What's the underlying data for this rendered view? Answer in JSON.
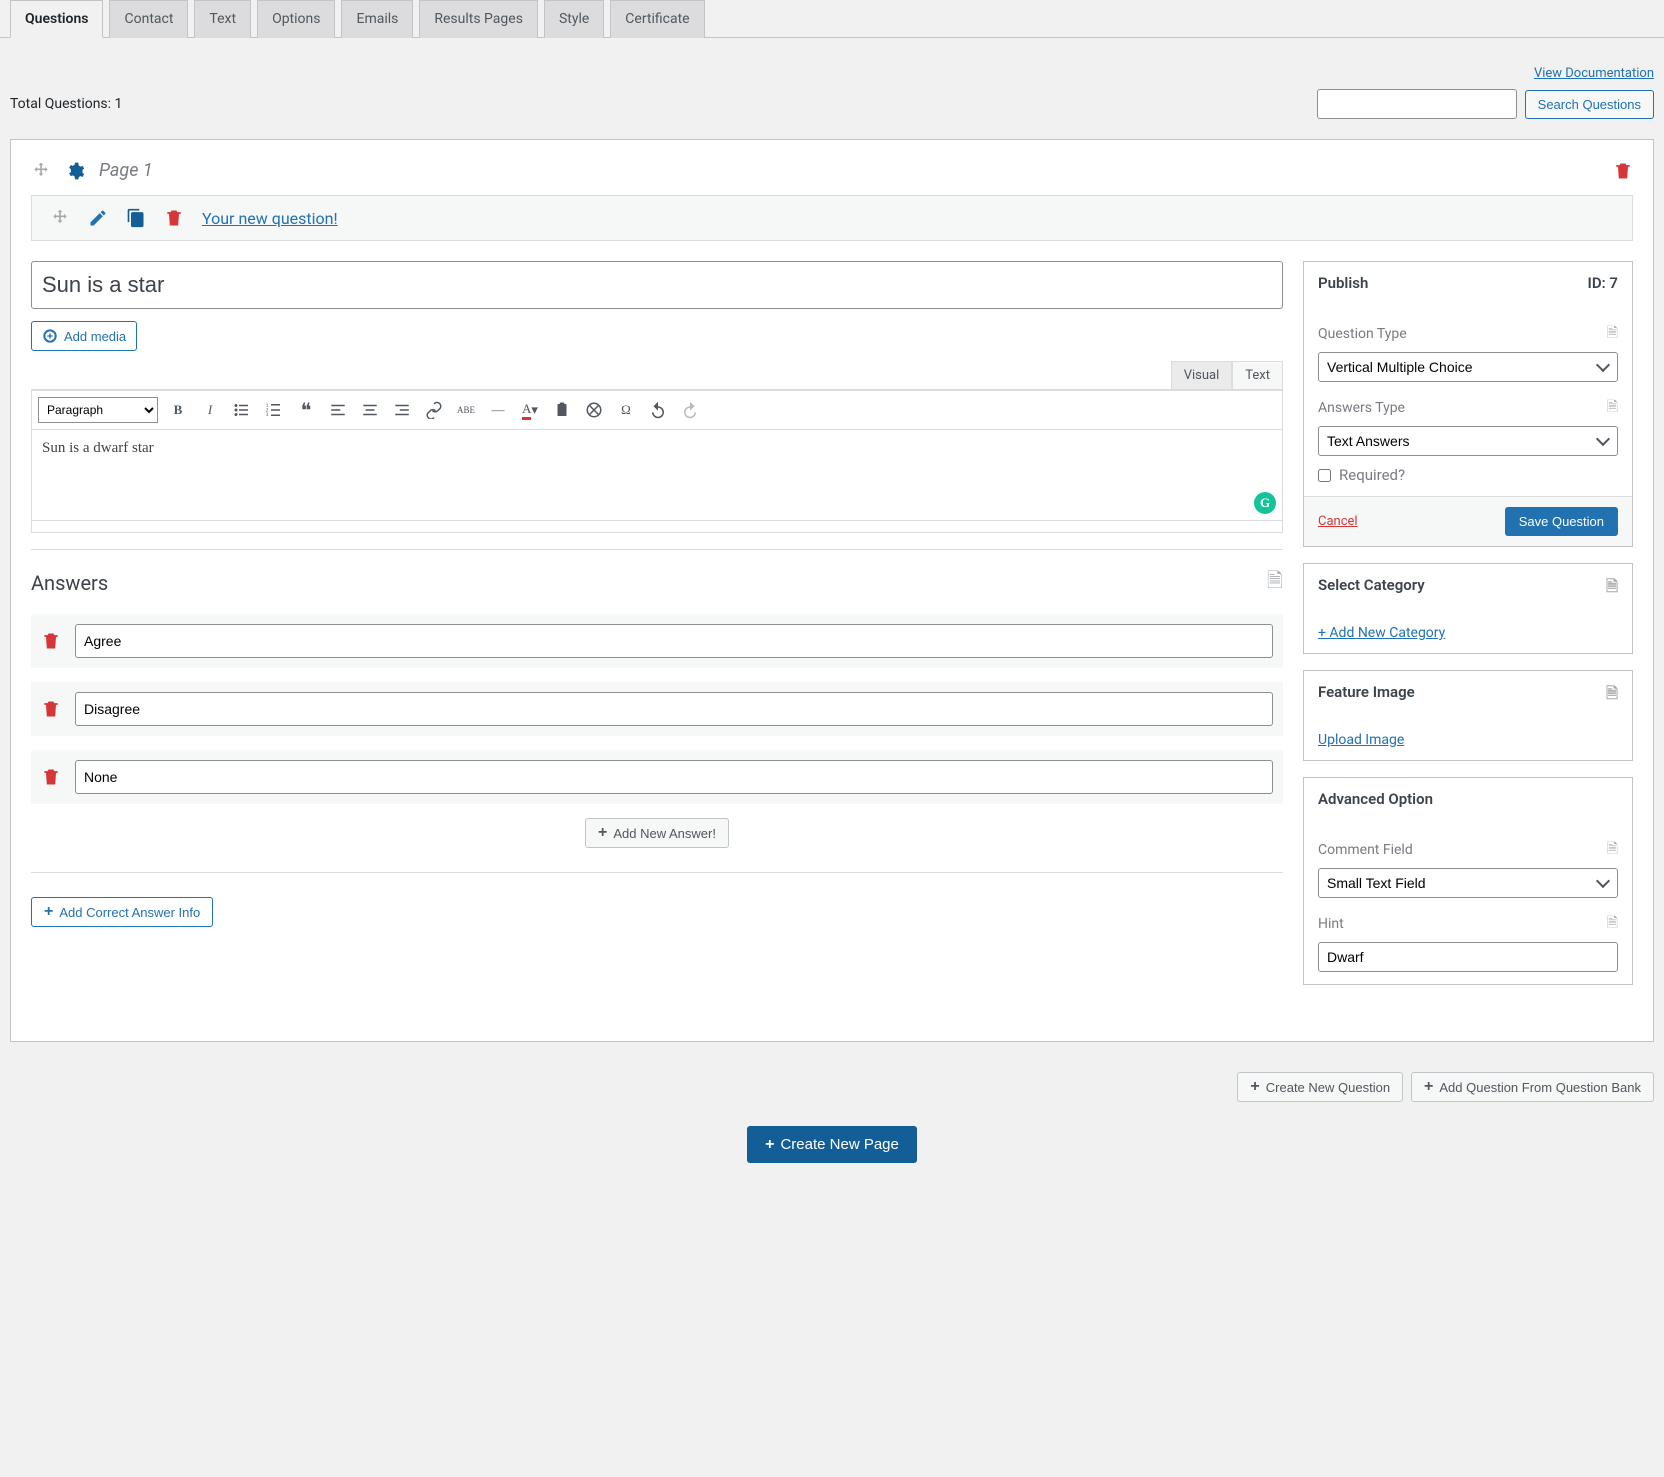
{
  "tabs": [
    "Questions",
    "Contact",
    "Text",
    "Options",
    "Emails",
    "Results Pages",
    "Style",
    "Certificate"
  ],
  "doc_link": "View Documentation",
  "total_q_label": "Total Questions: ",
  "total_q_count": "1",
  "search_btn": "Search Questions",
  "page_title": "Page 1",
  "q_prompt": "Your new question!",
  "question_title": "Sun is a star",
  "add_media": "Add media",
  "ed_tabs": {
    "visual": "Visual",
    "text": "Text"
  },
  "paragraph_sel": "Paragraph",
  "editor_content": "Sun is a dwarf star",
  "answers_heading": "Answers",
  "answers": [
    "Agree",
    "Disagree",
    "None"
  ],
  "add_answer": "Add New Answer!",
  "add_correct": "Add Correct Answer Info",
  "publish": {
    "title": "Publish",
    "id_label": "ID: ",
    "id_val": "7",
    "qtype_label": "Question Type",
    "qtype_val": "Vertical Multiple Choice",
    "atype_label": "Answers Type",
    "atype_val": "Text Answers",
    "required": "Required?",
    "cancel": "Cancel",
    "save": "Save Question"
  },
  "category": {
    "title": "Select Category",
    "add": "+ Add New Category"
  },
  "feature": {
    "title": "Feature Image",
    "upload": "Upload Image"
  },
  "advanced": {
    "title": "Advanced Option",
    "comment_label": "Comment Field",
    "comment_val": "Small Text Field",
    "hint_label": "Hint",
    "hint_val": "Dwarf"
  },
  "bottom": {
    "create_q": "Create New Question",
    "add_from_bank": "Add Question From Question Bank"
  },
  "create_page": "Create New Page"
}
